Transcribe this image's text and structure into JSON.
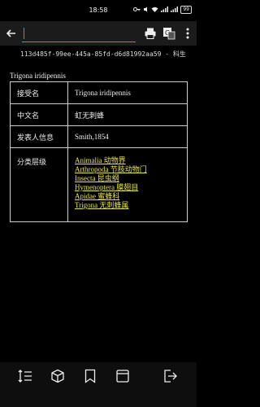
{
  "status_bar": {
    "time": "18:58",
    "battery": "99"
  },
  "url_line": {
    "text": "113d485f-99ee-445a-85fd-d6d81992aa59 - 科生"
  },
  "page": {
    "title": "Trigona iridipennis",
    "rows": [
      {
        "label": "接受名",
        "value": "Trigona iridipennis"
      },
      {
        "label": "中文名",
        "value": "虹无刺蜂"
      },
      {
        "label": "发表人信息",
        "value": "Smith,1854"
      }
    ],
    "classification": {
      "label": "分类层级",
      "links": [
        "Animalia 动物界",
        "Arthropoda 节肢动物门",
        "Insecta 昆虫纲",
        "Hymenoptera 膜翅目",
        "Apidae 蜜蜂科",
        "Trigona 无刺蜂属"
      ]
    }
  },
  "colors": {
    "accent": "#1fb0b6",
    "link": "#e9e34a"
  }
}
